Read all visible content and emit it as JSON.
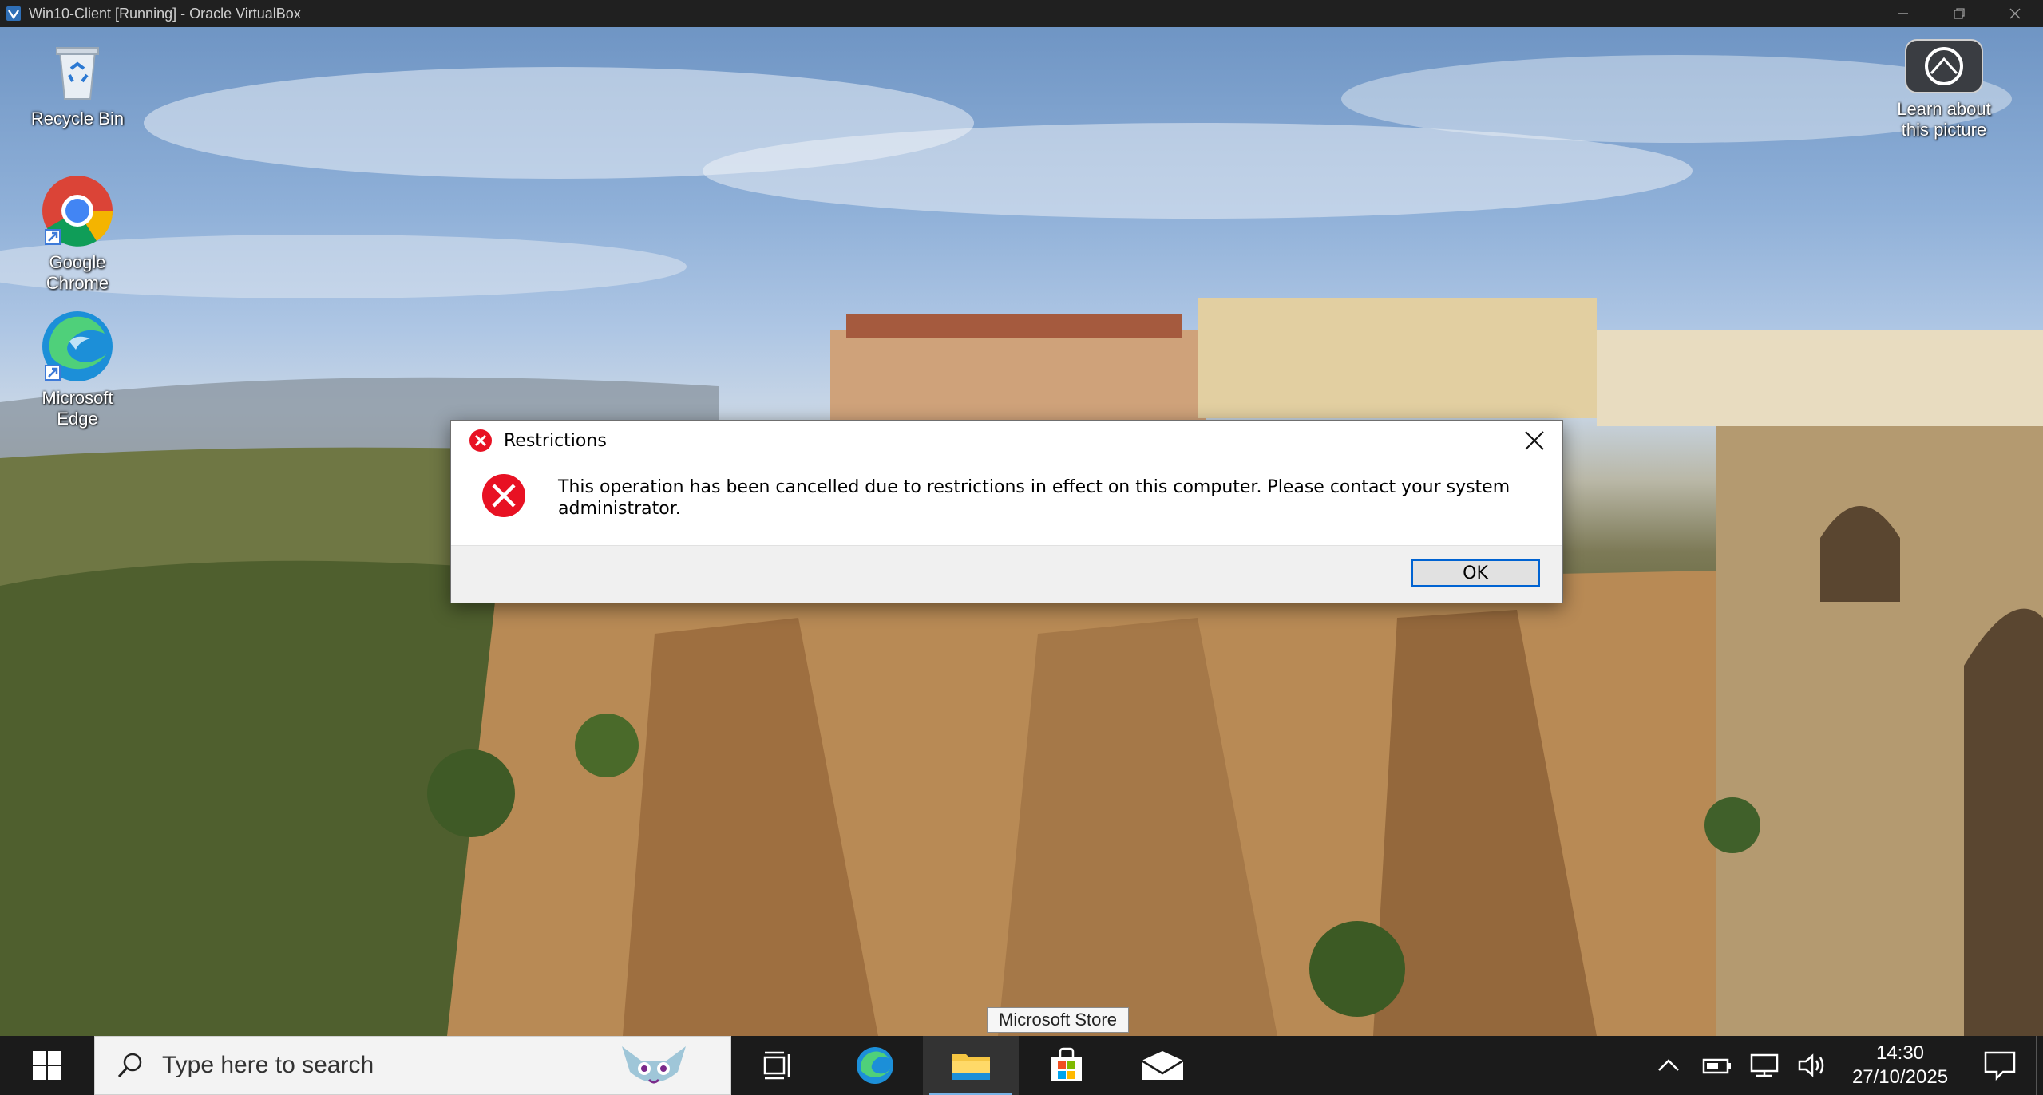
{
  "host_window": {
    "title": "Win10-Client [Running] - Oracle VirtualBox",
    "controls": [
      "minimize",
      "restore",
      "close"
    ]
  },
  "desktop": {
    "icons": [
      {
        "label": "Recycle Bin",
        "icon": "recycle-bin-icon"
      },
      {
        "label": "Google Chrome",
        "icon": "chrome-icon"
      },
      {
        "label": "Microsoft Edge",
        "icon": "edge-icon"
      }
    ],
    "spotlight": {
      "label": "Learn about this picture",
      "icon": "camera-icon"
    }
  },
  "dialog": {
    "title": "Restrictions",
    "message": "This operation has been cancelled due to restrictions in effect on this computer. Please contact your system administrator.",
    "ok_label": "OK",
    "icon": "error-icon",
    "accent": "#e81123"
  },
  "tooltip": {
    "text": "Microsoft Store"
  },
  "taskbar": {
    "search_placeholder": "Type here to search",
    "apps": [
      {
        "name": "Task View",
        "icon": "task-view-icon"
      },
      {
        "name": "Microsoft Edge",
        "icon": "edge-icon"
      },
      {
        "name": "File Explorer",
        "icon": "folder-icon",
        "state": "active"
      },
      {
        "name": "Microsoft Store",
        "icon": "store-icon"
      },
      {
        "name": "Mail",
        "icon": "mail-icon"
      }
    ],
    "tray_icons": [
      "chevron-up-icon",
      "battery-icon",
      "network-icon",
      "volume-icon"
    ],
    "time": "14:30",
    "date": "27/10/2025"
  },
  "colors": {
    "taskbar": "#1b1b1b",
    "ok_border": "#0063d2",
    "error_red": "#e81123"
  }
}
